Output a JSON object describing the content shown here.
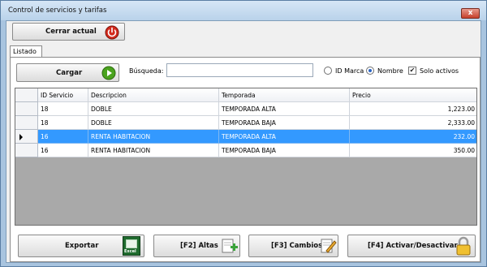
{
  "window": {
    "title": "Control de servicios y tarifas",
    "close_glyph": "x"
  },
  "toolbar": {
    "close_current_label": "Cerrar actual"
  },
  "tabs": [
    {
      "label": "Listado"
    }
  ],
  "search": {
    "load_label": "Cargar",
    "label": "Búsqueda:",
    "value": ""
  },
  "options": {
    "id_marca_label": "ID Marca",
    "nombre_label": "Nombre",
    "solo_activos_label": "Solo activos",
    "selected_radio": "Nombre",
    "solo_activos_checked": true
  },
  "grid": {
    "columns": [
      "ID Servicio",
      "Descripcion",
      "Temporada",
      "Precio"
    ],
    "rows": [
      {
        "id": "18",
        "desc": "DOBLE",
        "temporada": "TEMPORADA ALTA",
        "precio": "1,223.00"
      },
      {
        "id": "18",
        "desc": "DOBLE",
        "temporada": "TEMPORADA BAJA",
        "precio": "2,333.00"
      },
      {
        "id": "16",
        "desc": "RENTA HABITACION",
        "temporada": "TEMPORADA ALTA",
        "precio": "232.00"
      },
      {
        "id": "16",
        "desc": "RENTA HABITACION",
        "temporada": "TEMPORADA BAJA",
        "precio": "350.00"
      }
    ],
    "selected_row": 2
  },
  "footer": {
    "export_label": "Exportar",
    "altas_label": "[F2] Altas",
    "cambios_label": "[F3] Cambios",
    "activar_label": "[F4] Activar/Desactivar",
    "excel_icon_text": "Excel"
  },
  "colors": {
    "selection": "#3399ff",
    "power_icon": "#d32a1c",
    "play_icon": "#4aa31e"
  }
}
